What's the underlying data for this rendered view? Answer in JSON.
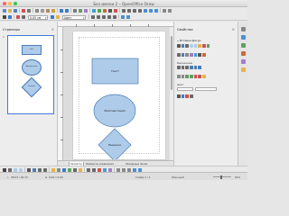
{
  "window": {
    "title": "Без имени 2 – OpenOffice Draw"
  },
  "toolbar": {
    "zoom_value": "0,00 см",
    "line_style": "Цвет"
  },
  "pages_panel": {
    "title": "Страницы",
    "thumb_number": "1",
    "shapes": {
      "rect": "Текст",
      "ellipse": "Фрагментация",
      "diamond": "Решение"
    }
  },
  "canvas": {
    "shapes": {
      "rect": "Текст",
      "ellipse": "Фрагментация",
      "diamond": "Решение"
    },
    "shape_color": "#aecbea",
    "shape_border": "#4a7db5"
  },
  "tabs": [
    {
      "label": "Разметка"
    },
    {
      "label": "Элементы управления"
    },
    {
      "label": "Размерные линии"
    }
  ],
  "sidebar": {
    "title": "Свойства",
    "section": "Вставка фигур",
    "group2_label": "Выражение",
    "group3_label": "Цвет"
  },
  "status": {
    "position": "28,03 / 26,72",
    "size": "0,00 x 0,00",
    "page": "Слайд 1 / 1",
    "layout": "Обычный",
    "zoom": "64%"
  }
}
